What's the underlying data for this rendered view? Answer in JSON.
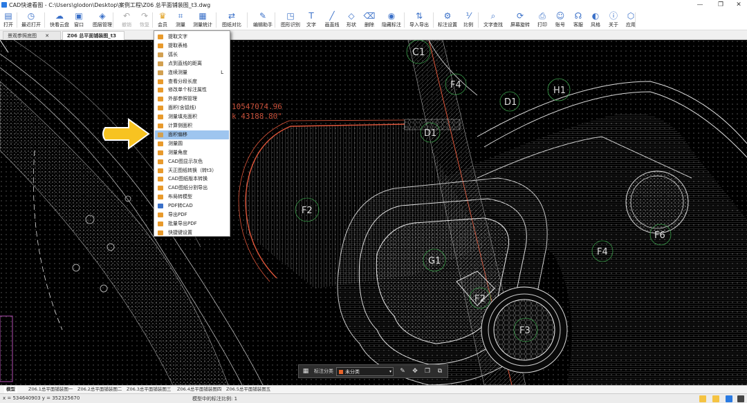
{
  "window": {
    "title": "CAD快速看图 - C:\\Users\\glodon\\Desktop\\案例工程\\Z06 总平面铺装图_t3.dwg",
    "minimize": "—",
    "restore": "❐",
    "close": "✕"
  },
  "toolbar": {
    "items": [
      {
        "label": "打开",
        "icon": "folder-icon"
      },
      {
        "label": "最近打开",
        "icon": "clock-icon"
      },
      {
        "label": "快看云盘",
        "icon": "cloud-icon"
      },
      {
        "label": "窗口",
        "icon": "window-icon"
      },
      {
        "label": "图层管理",
        "icon": "layers-icon"
      },
      {
        "label": "撤销",
        "icon": "undo-icon"
      },
      {
        "label": "恢复",
        "icon": "redo-icon"
      },
      {
        "label": "会员",
        "icon": "vip-icon"
      },
      {
        "label": "测量",
        "icon": "measure-icon"
      },
      {
        "label": "测量统计",
        "icon": "stats-icon"
      },
      {
        "label": "图纸对比",
        "icon": "compare-icon"
      },
      {
        "label": "编辑助手",
        "icon": "edit-icon"
      },
      {
        "label": "图形识别",
        "icon": "shape-recog-icon"
      },
      {
        "label": "文字",
        "icon": "text-icon"
      },
      {
        "label": "画直线",
        "icon": "line-icon"
      },
      {
        "label": "形状",
        "icon": "shape-icon"
      },
      {
        "label": "删除",
        "icon": "eraser-icon"
      },
      {
        "label": "隐藏标注",
        "icon": "eye-off-icon"
      },
      {
        "label": "导入导出",
        "icon": "import-icon"
      },
      {
        "label": "标注设置",
        "icon": "settings-icon"
      },
      {
        "label": "比例",
        "icon": "ratio-icon"
      },
      {
        "label": "文字查找",
        "icon": "search-text-icon"
      },
      {
        "label": "屏幕旋转",
        "icon": "rotate-icon"
      },
      {
        "label": "打印",
        "icon": "print-icon"
      },
      {
        "label": "账号",
        "icon": "user-icon"
      },
      {
        "label": "客服",
        "icon": "headset-icon"
      },
      {
        "label": "风格",
        "icon": "style-icon"
      },
      {
        "label": "关于",
        "icon": "info-icon"
      },
      {
        "label": "应用",
        "icon": "apps-icon"
      }
    ]
  },
  "tabs": [
    {
      "label": "景观参照底图",
      "close": "✕"
    },
    {
      "label": "Z06 总平面铺装图_t3",
      "close": "✕"
    }
  ],
  "menu": {
    "items": [
      {
        "label": "提取文字",
        "color": "#e89a2c"
      },
      {
        "label": "提取表格",
        "color": "#e89a2c"
      },
      {
        "label": "弧长",
        "color": "#d2a050"
      },
      {
        "label": "点到直线的距离",
        "color": "#d2a050"
      },
      {
        "label": "连续测量",
        "color": "#d2a050",
        "shortcut": "L"
      },
      {
        "label": "查看分段长度",
        "color": "#e89a2c"
      },
      {
        "label": "修改单个标注属性",
        "color": "#e89a2c"
      },
      {
        "label": "外部参照管理",
        "color": "#e89a2c"
      },
      {
        "label": "面积(含弧线)",
        "color": "#e89a2c"
      },
      {
        "label": "测量填充面积",
        "color": "#e89a2c"
      },
      {
        "label": "计算侧面积",
        "color": "#e89a2c"
      },
      {
        "label": "面积偏移",
        "color": "#d2a050"
      },
      {
        "label": "测量圆",
        "color": "#e89a2c"
      },
      {
        "label": "测量角度",
        "color": "#e89a2c"
      },
      {
        "label": "CAD图显示灰色",
        "color": "#e89a2c"
      },
      {
        "label": "天正图纸转换（转t3）",
        "color": "#e89a2c"
      },
      {
        "label": "CAD图纸版本转换",
        "color": "#e89a2c"
      },
      {
        "label": "CAD图纸分割导出",
        "color": "#e89a2c"
      },
      {
        "label": "布局转模型",
        "color": "#e89a2c"
      },
      {
        "label": "PDF转CAD",
        "color": "#3a70c8"
      },
      {
        "label": "导出PDF",
        "color": "#e89a2c"
      },
      {
        "label": "批量导出PDF",
        "color": "#e89a2c"
      },
      {
        "label": "快捷键设置",
        "color": "#e89a2c"
      }
    ],
    "highlighted": 11
  },
  "drawing": {
    "area_text_1": "10547074.96",
    "area_text_2": "k 43188.80\"",
    "labels": [
      "C1",
      "F4",
      "H1",
      "D1",
      "D1",
      "F2",
      "G1",
      "F2",
      "F3",
      "F4",
      "F6"
    ]
  },
  "bottombar": {
    "category_label": "标注分类",
    "category_value": "未分类",
    "grid_icon": "▦",
    "dropdown": "▾",
    "edit_icon": "✎",
    "move_icon": "✥",
    "copy_icon": "❐",
    "paste_icon": "⧉"
  },
  "layout_tabs": [
    "模型",
    "Z06.1总平面铺装图一",
    "Z06.2总平面铺装图二",
    "Z06.3总平面铺装图三",
    "Z06.4总平面铺装图四",
    "Z06.5总平面铺装图五"
  ],
  "status": {
    "coords": "x = 534640903  y = 352325670",
    "scale_label": "模型中的标注比例: 1"
  },
  "colors": {
    "annotation_red": "#e0563a",
    "highlight": "#9ec5ef",
    "arrow": "#f7c321"
  }
}
